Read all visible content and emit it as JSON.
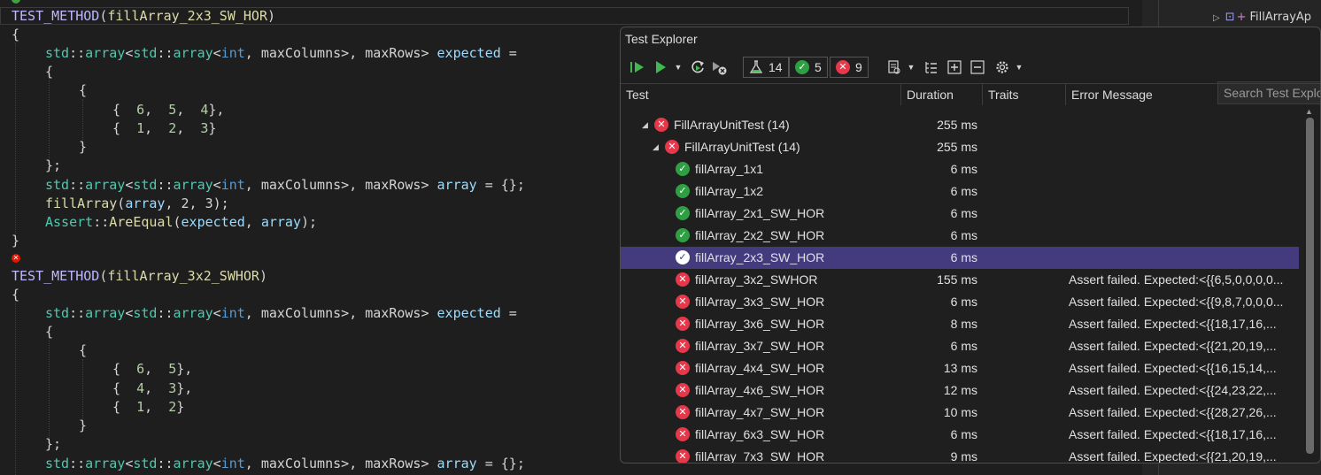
{
  "editor": {
    "line1": {
      "macro": "TEST_METHOD",
      "open": "(",
      "name": "fillArray_2x3_SW_HOR",
      "close": ")"
    },
    "brace_open": "{",
    "brace_close": "}",
    "ns": "std",
    "sep": "::",
    "type_array": "array",
    "type_int": "int",
    "lt": "<",
    "gt": ">",
    "comma_sp": ", ",
    "max_cols": "maxColumns",
    "max_rows": "maxRows",
    "expected": "expected",
    "array_var": "array",
    "eq": " = ",
    "eq_brace": " = {};",
    "fill_fn": "fillArray",
    "call_args": ", 2, 3);",
    "assert_cls": "Assert",
    "are_equal": "AreEqual",
    "semi_brace": "};",
    "block1_rows": [
      [
        "6",
        "5",
        "4"
      ],
      [
        "1",
        "2",
        "3"
      ]
    ],
    "line2": {
      "macro": "TEST_METHOD",
      "open": "(",
      "name": "fillArray_3x2_SWHOR",
      "close": ")"
    },
    "block2_rows": [
      [
        "6",
        "5"
      ],
      [
        "4",
        "3"
      ],
      [
        "1",
        "2"
      ]
    ]
  },
  "solution": {
    "item": "FillArrayAp"
  },
  "test_explorer": {
    "title": "Test Explorer",
    "counts": {
      "total": "14",
      "passed": "5",
      "failed": "9"
    },
    "search_placeholder": "Search Test Explo",
    "columns": {
      "test": "Test",
      "duration": "Duration",
      "traits": "Traits",
      "error": "Error Message"
    },
    "rows": [
      {
        "level": 0,
        "status": "fail",
        "expand": "◢",
        "name": "FillArrayUnitTest  (14)",
        "duration": "255 ms",
        "error": ""
      },
      {
        "level": 1,
        "status": "fail",
        "expand": "◢",
        "name": "FillArrayUnitTest  (14)",
        "duration": "255 ms",
        "error": ""
      },
      {
        "level": 2,
        "status": "pass",
        "name": "fillArray_1x1",
        "duration": "6 ms",
        "error": ""
      },
      {
        "level": 2,
        "status": "pass",
        "name": "fillArray_1x2",
        "duration": "6 ms",
        "error": ""
      },
      {
        "level": 2,
        "status": "pass",
        "name": "fillArray_2x1_SW_HOR",
        "duration": "6 ms",
        "error": ""
      },
      {
        "level": 2,
        "status": "pass",
        "name": "fillArray_2x2_SW_HOR",
        "duration": "6 ms",
        "error": ""
      },
      {
        "level": 2,
        "status": "pass",
        "selected": true,
        "name": "fillArray_2x3_SW_HOR",
        "duration": "6 ms",
        "error": ""
      },
      {
        "level": 2,
        "status": "fail",
        "name": "fillArray_3x2_SWHOR",
        "duration": "155 ms",
        "error": "Assert failed. Expected:<{{6,5,0,0,0,0..."
      },
      {
        "level": 2,
        "status": "fail",
        "name": "fillArray_3x3_SW_HOR",
        "duration": "6 ms",
        "error": "Assert failed. Expected:<{{9,8,7,0,0,0..."
      },
      {
        "level": 2,
        "status": "fail",
        "name": "fillArray_3x6_SW_HOR",
        "duration": "8 ms",
        "error": "Assert failed. Expected:<{{18,17,16,..."
      },
      {
        "level": 2,
        "status": "fail",
        "name": "fillArray_3x7_SW_HOR",
        "duration": "6 ms",
        "error": "Assert failed. Expected:<{{21,20,19,..."
      },
      {
        "level": 2,
        "status": "fail",
        "name": "fillArray_4x4_SW_HOR",
        "duration": "13 ms",
        "error": "Assert failed. Expected:<{{16,15,14,..."
      },
      {
        "level": 2,
        "status": "fail",
        "name": "fillArray_4x6_SW_HOR",
        "duration": "12 ms",
        "error": "Assert failed. Expected:<{{24,23,22,..."
      },
      {
        "level": 2,
        "status": "fail",
        "name": "fillArray_4x7_SW_HOR",
        "duration": "10 ms",
        "error": "Assert failed. Expected:<{{28,27,26,..."
      },
      {
        "level": 2,
        "status": "fail",
        "name": "fillArray_6x3_SW_HOR",
        "duration": "6 ms",
        "error": "Assert failed. Expected:<{{18,17,16,..."
      },
      {
        "level": 2,
        "status": "fail",
        "name": "fillArray_7x3_SW_HOR",
        "duration": "9 ms",
        "error": "Assert failed. Expected:<{{21,20,19,..."
      }
    ]
  },
  "colors": {
    "selection": "#433b7e",
    "pass": "#2ea043",
    "fail": "#e5384a"
  },
  "icons": [
    "run-all-icon",
    "run-icon",
    "rerun-icon",
    "cancel-icon",
    "flask-icon",
    "filter-icon",
    "hierarchy-icon",
    "expand-all-icon",
    "collapse-all-icon",
    "settings-icon",
    "pass-icon",
    "fail-icon"
  ]
}
